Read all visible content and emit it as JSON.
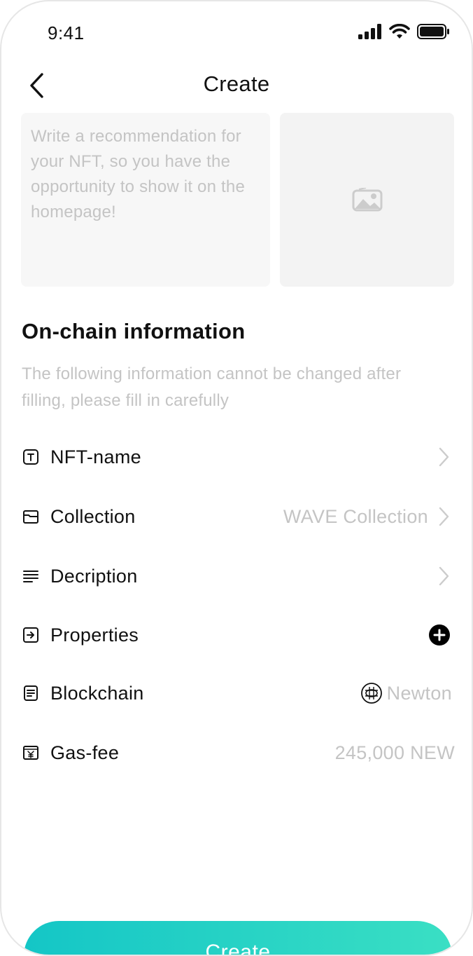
{
  "status_bar": {
    "time": "9:41"
  },
  "header": {
    "title": "Create"
  },
  "recommendation": {
    "placeholder": "Write a recommendation for your NFT, so you have the opportunity to show it on the homepage!"
  },
  "section": {
    "title": "On-chain information",
    "description": "The following information cannot be changed after filling, please fill in carefully"
  },
  "rows": {
    "nft_name": {
      "label": "NFT-name",
      "icon": "text-box-icon"
    },
    "collection": {
      "label": "Collection",
      "value": "WAVE Collection",
      "icon": "folder-icon"
    },
    "description": {
      "label": "Decription",
      "icon": "lines-icon"
    },
    "properties": {
      "label": "Properties",
      "icon": "arrow-box-icon"
    },
    "blockchain": {
      "label": "Blockchain",
      "value": "Newton",
      "icon": "document-icon"
    },
    "gas_fee": {
      "label": "Gas-fee",
      "value": "245,000 NEW",
      "icon": "yen-box-icon"
    }
  },
  "create_button": {
    "label": "Create"
  },
  "colors": {
    "accent_start": "#14c6c6",
    "accent_end": "#3adfc4",
    "placeholder": "#c4c4c4"
  }
}
